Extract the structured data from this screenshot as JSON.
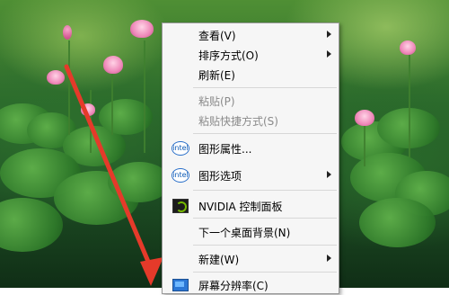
{
  "context_menu": {
    "items": [
      {
        "label": "查看(V)",
        "has_submenu": true,
        "disabled": false
      },
      {
        "label": "排序方式(O)",
        "has_submenu": true,
        "disabled": false
      },
      {
        "label": "刷新(E)",
        "has_submenu": false,
        "disabled": false
      },
      {
        "label": "粘贴(P)",
        "has_submenu": false,
        "disabled": true
      },
      {
        "label": "粘贴快捷方式(S)",
        "has_submenu": false,
        "disabled": true
      },
      {
        "label": "图形属性...",
        "has_submenu": false,
        "disabled": false,
        "icon_text": "intel"
      },
      {
        "label": "图形选项",
        "has_submenu": true,
        "disabled": false,
        "icon_text": "intel"
      },
      {
        "label": "NVIDIA 控制面板",
        "has_submenu": false,
        "disabled": false,
        "icon": "nvidia-icon"
      },
      {
        "label": "下一个桌面背景(N)",
        "has_submenu": false,
        "disabled": false
      },
      {
        "label": "新建(W)",
        "has_submenu": true,
        "disabled": false
      },
      {
        "label": "屏幕分辨率(C)",
        "has_submenu": false,
        "disabled": false,
        "icon": "display-icon"
      }
    ]
  },
  "annotation": {
    "arrow_color": "#e53a2a"
  }
}
